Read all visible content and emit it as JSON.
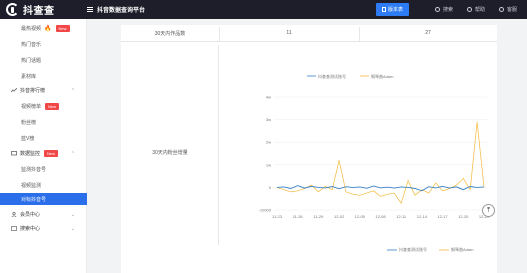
{
  "header": {
    "logo_text": "抖查查",
    "platform_title": "抖音数据查询平台",
    "vip_label": "版本表",
    "search_label": "搜索",
    "help_label": "帮助",
    "service_label": "客服"
  },
  "sidebar": {
    "items": [
      {
        "label": "最热视频",
        "badge": "New",
        "fire": "🔥"
      },
      {
        "label": "热门音乐"
      },
      {
        "label": "热门话题"
      },
      {
        "label": "素材库"
      },
      {
        "label": "抖音排行榜"
      },
      {
        "label": "视频榜单",
        "badge": "New"
      },
      {
        "label": "粉丝榜"
      },
      {
        "label": "蓝V榜"
      },
      {
        "label": "数据监控",
        "badge": "New"
      },
      {
        "label": "监测抖音号"
      },
      {
        "label": "视频监测"
      },
      {
        "label": "对标抖音号"
      },
      {
        "label": "会员中心"
      },
      {
        "label": "搜索中心"
      }
    ]
  },
  "main": {
    "row_label": "30天内作品数",
    "row_value_1": "11",
    "row_value_2": "27",
    "metric_label": "30天内粉丝增量"
  },
  "chart_data": {
    "type": "line",
    "legend": [
      "抖查查测试账号",
      "钢琴曲Adam"
    ],
    "colors": {
      "series_1": "#3b82c4",
      "series_2": "#f2b93b"
    },
    "x_ticks": [
      "11-23",
      "11-26",
      "11-29",
      "12-02",
      "12-05",
      "12-08",
      "12-11",
      "12-14",
      "12-17",
      "12-20",
      "12-23"
    ],
    "y_ticks": [
      "4w",
      "3w",
      "2w",
      "1w",
      "0",
      "-10000"
    ],
    "ylim": [
      -10000,
      40000
    ],
    "series": [
      {
        "name": "抖查查测试账号",
        "values": [
          0,
          200,
          -500,
          800,
          -300,
          500,
          0,
          -200,
          400,
          -600,
          300,
          -100,
          200,
          -400,
          600,
          -200,
          100,
          -300,
          200,
          0,
          -500,
          -1500,
          300,
          -200,
          500,
          -300,
          200,
          -1000,
          400,
          0,
          200
        ]
      },
      {
        "name": "钢琴曲Adam",
        "values": [
          0,
          -1000,
          -2000,
          -1500,
          -500,
          1000,
          -2000,
          500,
          -1000,
          12000,
          -2000,
          -3000,
          -3500,
          -2500,
          -1500,
          -4000,
          -3000,
          -2500,
          -7000,
          3000,
          -3500,
          -1000,
          -2500,
          2000,
          -1500,
          -500,
          1000,
          4000,
          -1000,
          29000,
          200
        ]
      }
    ]
  },
  "scroll_top_icon": "arrow-up-icon"
}
